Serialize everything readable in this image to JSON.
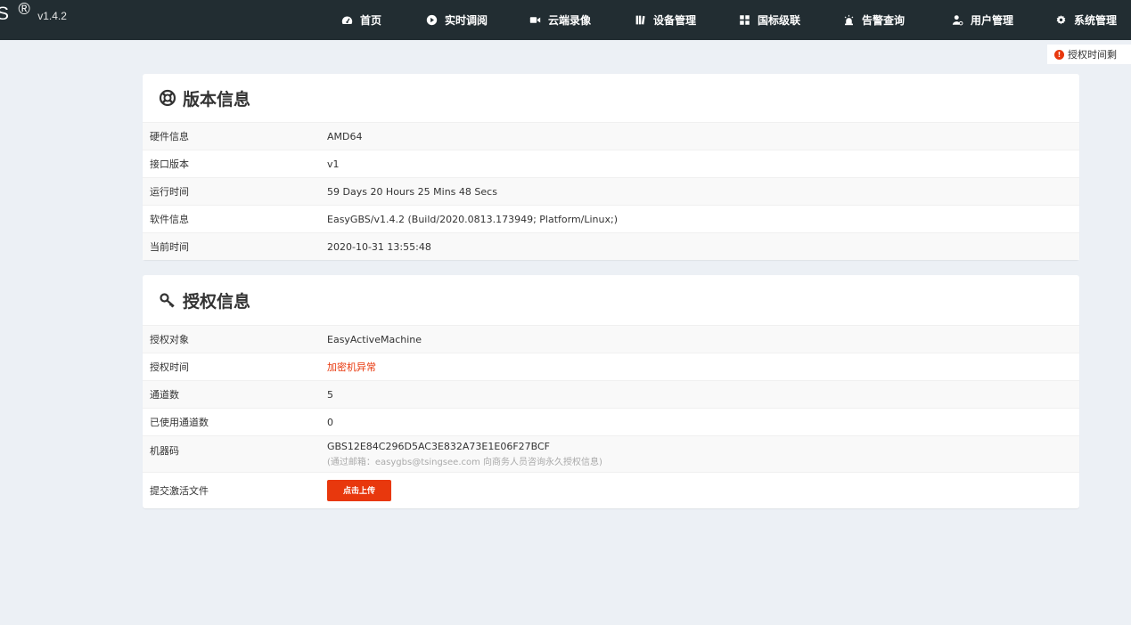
{
  "brand": {
    "name": "BS",
    "registered": "®",
    "version": "v1.4.2"
  },
  "nav": [
    {
      "label": "首页",
      "icon": "dashboard-icon"
    },
    {
      "label": "实时调阅",
      "icon": "play-circle-icon"
    },
    {
      "label": "云端录像",
      "icon": "video-camera-icon"
    },
    {
      "label": "设备管理",
      "icon": "books-icon"
    },
    {
      "label": "国标级联",
      "icon": "grid-icon"
    },
    {
      "label": "告警查询",
      "icon": "alarm-light-icon"
    },
    {
      "label": "用户管理",
      "icon": "user-gear-icon"
    },
    {
      "label": "系统管理",
      "icon": "gear-icon"
    }
  ],
  "notice": {
    "icon": "exclamation-circle-icon",
    "text": "授权时间剩"
  },
  "version_panel": {
    "title": "版本信息",
    "icon": "lifebuoy-icon",
    "rows": [
      {
        "label": "硬件信息",
        "value": "AMD64"
      },
      {
        "label": "接口版本",
        "value": "v1"
      },
      {
        "label": "运行时间",
        "value": "59 Days 20 Hours 25 Mins 48 Secs"
      },
      {
        "label": "软件信息",
        "value": "EasyGBS/v1.4.2 (Build/2020.0813.173949; Platform/Linux;)"
      },
      {
        "label": "当前时间",
        "value": "2020-10-31 13:55:48"
      }
    ]
  },
  "license_panel": {
    "title": "授权信息",
    "icon": "key-icon",
    "rows": [
      {
        "label": "授权对象",
        "value": "EasyActiveMachine"
      },
      {
        "label": "授权时间",
        "value": "加密机异常"
      },
      {
        "label": "通道数",
        "value": "5"
      },
      {
        "label": "已使用通道数",
        "value": "0"
      },
      {
        "label": "机器码",
        "value": "GBS12E84C296D5AC3E832A73E1E06F27BCF",
        "hint": "(通过邮箱：easygbs@tsingsee.com 向商务人员咨询永久授权信息)"
      },
      {
        "label": "提交激活文件",
        "button": "点击上传"
      }
    ]
  },
  "colors": {
    "navbar": "#222d32",
    "accent": "#e8380d",
    "background": "#ecf0f5"
  }
}
